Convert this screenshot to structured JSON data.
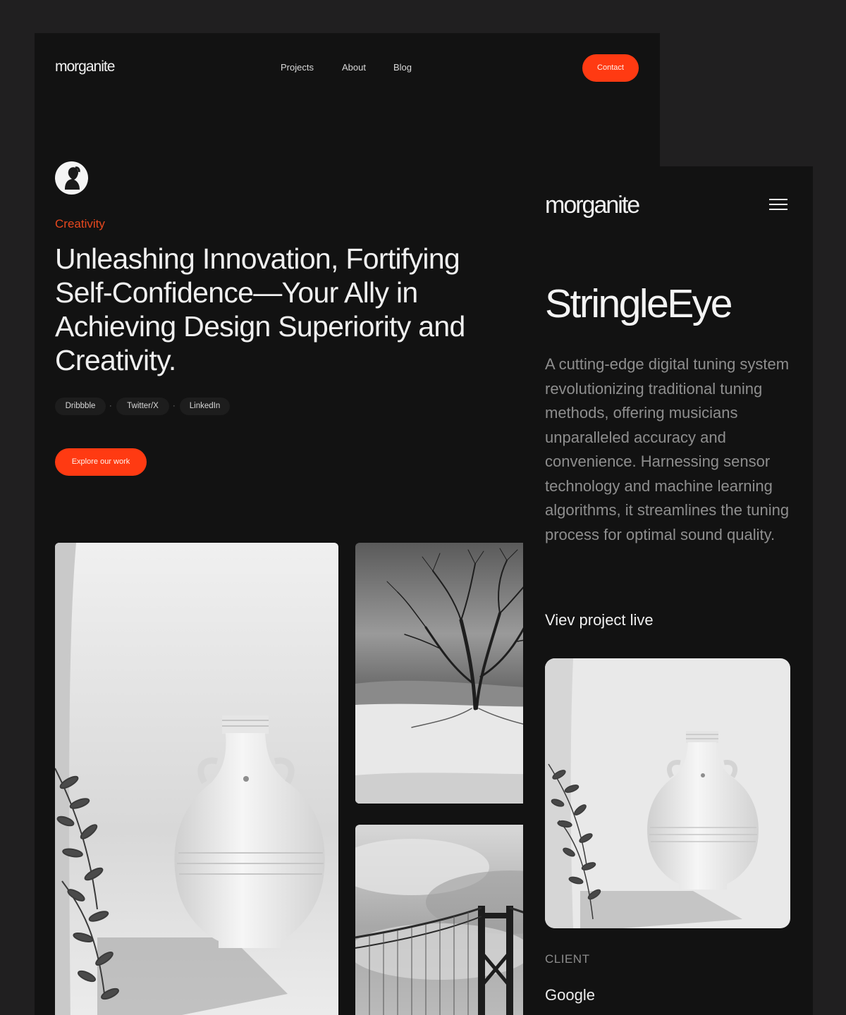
{
  "desktop": {
    "logo": "morganite",
    "nav": [
      "Projects",
      "About",
      "Blog"
    ],
    "contact_label": "Contact",
    "eyebrow": "Creativity",
    "headline": "Unleashing Innovation, Fortifying Self-Confidence—Your Ally in Achieving Design Superiority and Creativity.",
    "socials": [
      "Dribbble",
      "Twitter/X",
      "LinkedIn"
    ],
    "separator": "·",
    "cta_label": "Explore our work"
  },
  "mobile": {
    "logo": "morganite",
    "title": "StringleEye",
    "description": "A cutting-edge digital tuning system revolutionizing traditional tuning methods, offering musicians unparalleled accuracy and convenience. Harnessing sensor technology and machine learning algorithms, it streamlines the tuning process for optimal sound quality.",
    "link_label": "Viev project live",
    "client_label": "CLIENT",
    "client_name": "Google"
  },
  "icons": [
    "menu-icon",
    "avatar"
  ],
  "colors": {
    "page_background": "#201f20",
    "panel_background": "#121212",
    "accent": "#ff3a12",
    "eyebrow": "#e7481e",
    "text_primary": "#f0f0f0",
    "text_muted": "#8e8e8e"
  }
}
